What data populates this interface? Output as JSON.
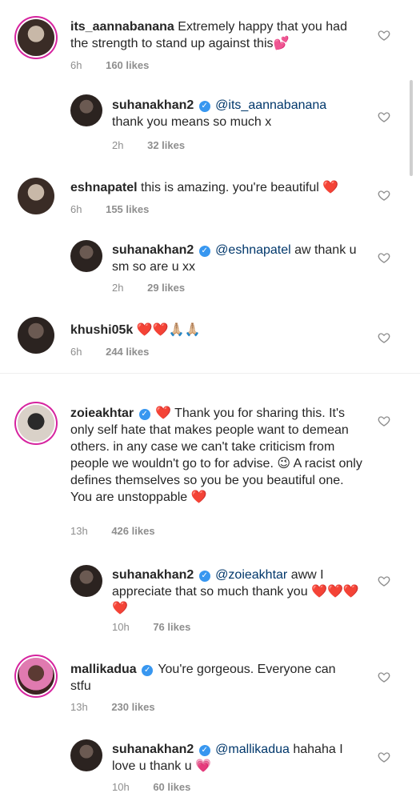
{
  "comments": [
    {
      "username": "its_aannabanana",
      "text": "Extremely happy that you had the strength to stand up against this💕",
      "time": "6h",
      "likes": "160 likes"
    },
    {
      "username": "suhanakhan2",
      "mention": "@its_aannabanana",
      "text": "thank you means so much x",
      "time": "2h",
      "likes": "32 likes"
    },
    {
      "username": "eshnapatel",
      "text": "this is amazing. you're beautiful ❤️",
      "time": "6h",
      "likes": "155 likes"
    },
    {
      "username": "suhanakhan2",
      "mention": "@eshnapatel",
      "text": "aw thank u sm so are u xx",
      "time": "2h",
      "likes": "29 likes"
    },
    {
      "username": "khushi05k",
      "text": "❤️❤️🙏🏼🙏🏼",
      "time": "6h",
      "likes": "244 likes"
    },
    {
      "username": "zoieakhtar",
      "text": "❤️ Thank you for sharing this. It's only self hate that makes people want to demean others. in any case we can't take criticism from people we wouldn't go to for advise. 😉 A racist only defines themselves so you be you beautiful one. You are unstoppable ❤️",
      "time": "13h",
      "likes": "426 likes"
    },
    {
      "username": "suhanakhan2",
      "mention": "@zoieakhtar",
      "text": "aww I appreciate that so much thank you ❤️❤️❤️❤️",
      "time": "10h",
      "likes": "76 likes"
    },
    {
      "username": "mallikadua",
      "text": "You're gorgeous. Everyone can stfu",
      "time": "13h",
      "likes": "230 likes"
    },
    {
      "username": "suhanakhan2",
      "mention": "@mallikadua",
      "text": "hahaha I love u thank u 💗",
      "time": "10h",
      "likes": "60 likes"
    }
  ],
  "icons": {
    "verified": "verified-badge-icon",
    "like": "heart-outline-icon"
  },
  "colors": {
    "verified": "#3897f0",
    "mention": "#00376b",
    "meta": "#8e8e8e"
  }
}
